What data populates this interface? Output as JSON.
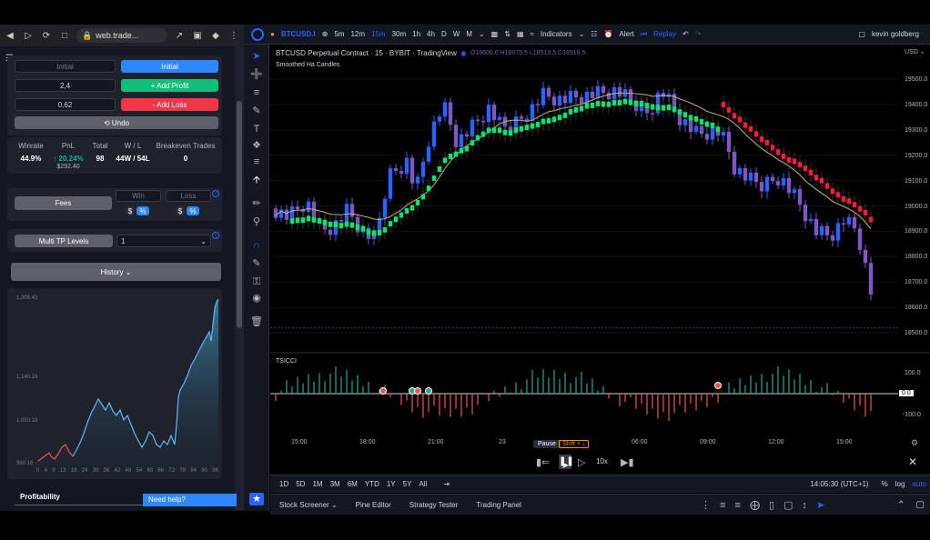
{
  "browser": {
    "url": "web.trade..."
  },
  "left_panel": {
    "initial_input": "Initial",
    "initial_button": "Initial",
    "profit_input": "2,4",
    "add_profit": "+ Add Profit",
    "loss_input": "0,62",
    "add_loss": "- Add Loss",
    "undo": "⟲ Undo",
    "stats": {
      "headers": [
        "Winrate",
        "PnL",
        "Total",
        "W / L",
        "Breakeven Trades"
      ],
      "winrate": "44.9%",
      "pnl": "↑ 20.24%",
      "pnl_abs": "$292.40",
      "total": "98",
      "wl": "44W / 54L",
      "breakeven": "0"
    },
    "fees": {
      "label": "Fees",
      "win_label": "Win",
      "loss_label": "Loss",
      "dollar": "$",
      "percent": "%"
    },
    "multi_tp": {
      "label": "Multi TP Levels",
      "value": "1"
    },
    "history_button": "History ⌄",
    "equity_chart": {
      "y_ticks": [
        "1,306.45",
        "1,140.16",
        "1,050.16",
        "960.16"
      ],
      "x_ticks": [
        "0",
        "4",
        "9",
        "13",
        "18",
        "24",
        "30",
        "36",
        "42",
        "48",
        "54",
        "60",
        "66",
        "72",
        "78",
        "84",
        "90",
        "96"
      ]
    },
    "profitability": "Profitability",
    "need_help": "Need help?"
  },
  "topbar": {
    "symbol": "BTCUSD.I",
    "intervals": [
      "5m",
      "12m",
      "15m",
      "30m",
      "1h",
      "4h",
      "D",
      "W",
      "M"
    ],
    "indicators": "Indicators",
    "alert": "Alert",
    "replay": "Replay",
    "user": "kevin goldberg"
  },
  "chart": {
    "title": "BTCUSD Perpetual Contract · 15 · BYBIT · TradingView",
    "ohlc": "O18606.0 H18675.5 L18519.5 C18519.5",
    "indicator": "Smoothed Ha Candles",
    "currency": "USD ⌄",
    "price_ticks": [
      "19500.0",
      "19400.0",
      "19300.0",
      "19200.0",
      "19100.0",
      "19000.0",
      "18900.0",
      "18800.0",
      "18700.0",
      "18600.0",
      "18500.0"
    ],
    "osc_label": "TSICCI",
    "osc_ticks": [
      "100.0",
      "0.0",
      "-100.0"
    ],
    "time_ticks": [
      "15:00",
      "18:00",
      "21:00",
      "23",
      "06:00",
      "09:00",
      "12:00",
      "15:00"
    ],
    "pause_tip": "Pause",
    "pause_shortcut": "Shift + ↓",
    "speed": "10x"
  },
  "range_bar": {
    "ranges": [
      "1D",
      "5D",
      "1M",
      "3M",
      "6M",
      "YTD",
      "1Y",
      "5Y",
      "All"
    ],
    "clock": "14:05:30 (UTC+1)",
    "percent": "%",
    "log": "log",
    "auto": "auto"
  },
  "bottom_tabs": [
    "Stock Screener ⌄",
    "Pine Editor",
    "Strategy Tester",
    "Trading Panel"
  ],
  "colors": {
    "bull": "#2962ff",
    "bear": "#7e57c2",
    "green_dots": "#00e676",
    "red_dots": "#ff1744"
  }
}
